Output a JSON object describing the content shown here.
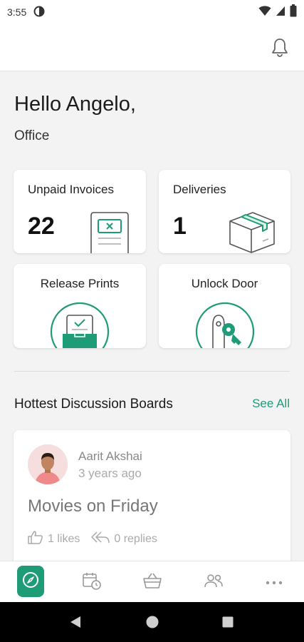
{
  "status_bar": {
    "time": "3:55"
  },
  "greeting": "Hello Angelo,",
  "location": "Office",
  "cards": {
    "unpaid_invoices": {
      "title": "Unpaid Invoices",
      "count": "22"
    },
    "deliveries": {
      "title": "Deliveries",
      "count": "1"
    },
    "release_prints": {
      "title": "Release Prints"
    },
    "unlock_door": {
      "title": "Unlock Door"
    }
  },
  "discussion": {
    "section_title": "Hottest Discussion Boards",
    "see_all": "See All",
    "post": {
      "author": "Aarit Akshai",
      "time_ago": "3 years ago",
      "title": "Movies on Friday",
      "likes": "1 likes",
      "replies": "0 replies"
    }
  },
  "bottom_nav": [
    "compass-icon",
    "calendar-clock-icon",
    "basket-icon",
    "people-icon",
    "more-icon"
  ],
  "colors": {
    "accent": "#1e9b77"
  }
}
